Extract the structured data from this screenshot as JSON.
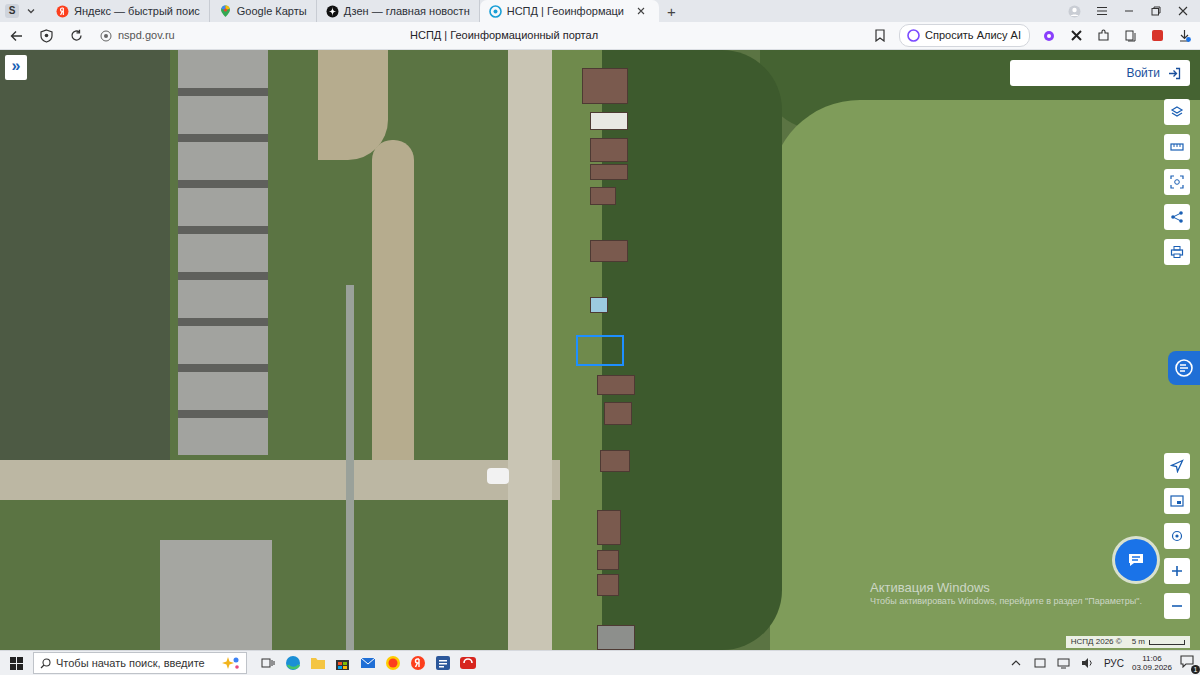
{
  "window": {
    "title": "НСПД | Геоинформационный портал"
  },
  "browser": {
    "menu_label": "S",
    "new_tab": "+"
  },
  "tabs": [
    {
      "label": "Яндекс — быстрый поис",
      "selected": false,
      "kind": "yandex"
    },
    {
      "label": "Google Карты",
      "selected": false,
      "kind": "maps"
    },
    {
      "label": "Дзен — главная новостн",
      "selected": false,
      "kind": "dzen"
    },
    {
      "label": "НСПД | Геоинформаци",
      "selected": true,
      "kind": "nspd"
    }
  ],
  "address": {
    "url": "nspd.gov.ru",
    "alice": "Спросить Алису AI"
  },
  "map": {
    "expand": "»",
    "login": "Войти",
    "copyright": "НСПД 2026 ©",
    "scale": "5 m",
    "parcel_selected": true
  },
  "watermark": {
    "title": "Активация Windows",
    "text": "Чтобы активировать Windows, перейдите в раздел \"Параметры\"."
  },
  "taskbar": {
    "search_placeholder": "Чтобы начать поиск, введите",
    "language": "РУС",
    "time": "11:06",
    "date": "03.09.2026",
    "notifications": "1"
  }
}
